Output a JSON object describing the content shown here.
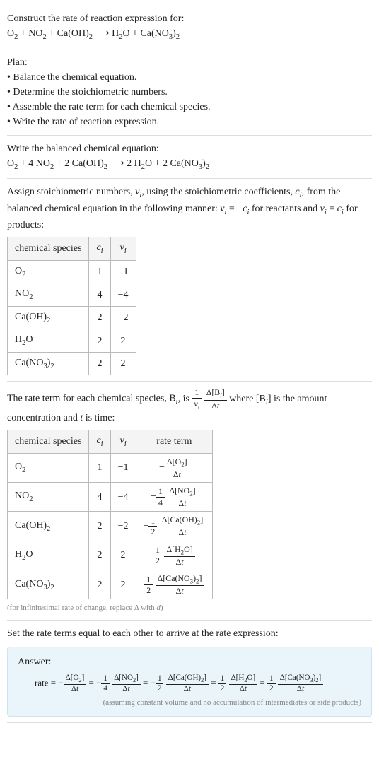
{
  "intro": {
    "prompt": "Construct the rate of reaction expression for:",
    "equation_html": "O<sub>2</sub> + NO<sub>2</sub> + Ca(OH)<sub>2</sub> ⟶ H<sub>2</sub>O + Ca(NO<sub>3</sub>)<sub>2</sub>"
  },
  "plan": {
    "title": "Plan:",
    "items": [
      "Balance the chemical equation.",
      "Determine the stoichiometric numbers.",
      "Assemble the rate term for each chemical species.",
      "Write the rate of reaction expression."
    ]
  },
  "balanced": {
    "intro": "Write the balanced chemical equation:",
    "equation_html": "O<sub>2</sub> + 4 NO<sub>2</sub> + 2 Ca(OH)<sub>2</sub> ⟶ 2 H<sub>2</sub>O + 2 Ca(NO<sub>3</sub>)<sub>2</sub>"
  },
  "stoich": {
    "intro_html": "Assign stoichiometric numbers, <i>ν<sub>i</sub></i>, using the stoichiometric coefficients, <i>c<sub>i</sub></i>, from the balanced chemical equation in the following manner: <i>ν<sub>i</sub></i> = −<i>c<sub>i</sub></i> for reactants and <i>ν<sub>i</sub></i> = <i>c<sub>i</sub></i> for products:",
    "headers": {
      "col1": "chemical species",
      "col2_html": "<i>c<sub>i</sub></i>",
      "col3_html": "<i>ν<sub>i</sub></i>"
    },
    "rows": [
      {
        "sp_html": "O<sub>2</sub>",
        "c": "1",
        "v": "−1"
      },
      {
        "sp_html": "NO<sub>2</sub>",
        "c": "4",
        "v": "−4"
      },
      {
        "sp_html": "Ca(OH)<sub>2</sub>",
        "c": "2",
        "v": "−2"
      },
      {
        "sp_html": "H<sub>2</sub>O",
        "c": "2",
        "v": "2"
      },
      {
        "sp_html": "Ca(NO<sub>3</sub>)<sub>2</sub>",
        "c": "2",
        "v": "2"
      }
    ]
  },
  "rate_terms": {
    "intro_pre": "The rate term for each chemical species, B",
    "intro_post_html": ", is <span class=\"frac\"><span class=\"num\">1</span><span class=\"den\"><i>ν<sub>i</sub></i></span></span> <span class=\"frac\"><span class=\"num\">Δ[B<sub><i>i</i></sub>]</span><span class=\"den\">Δ<i>t</i></span></span> where [B<sub><i>i</i></sub>] is the amount concentration and <i>t</i> is time:",
    "headers": {
      "col1": "chemical species",
      "col2_html": "<i>c<sub>i</sub></i>",
      "col3_html": "<i>ν<sub>i</sub></i>",
      "col4": "rate term"
    },
    "rows": [
      {
        "sp_html": "O<sub>2</sub>",
        "c": "1",
        "v": "−1",
        "term_html": "<span class=\"neg\">−<span class=\"frac\"><span class=\"num\">Δ[O<sub>2</sub>]</span><span class=\"den\">Δ<i>t</i></span></span></span>"
      },
      {
        "sp_html": "NO<sub>2</sub>",
        "c": "4",
        "v": "−4",
        "term_html": "<span class=\"neg\">−<span class=\"frac\"><span class=\"num\">1</span><span class=\"den\">4</span></span> <span class=\"frac\"><span class=\"num\">Δ[NO<sub>2</sub>]</span><span class=\"den\">Δ<i>t</i></span></span></span>"
      },
      {
        "sp_html": "Ca(OH)<sub>2</sub>",
        "c": "2",
        "v": "−2",
        "term_html": "<span class=\"neg\">−<span class=\"frac\"><span class=\"num\">1</span><span class=\"den\">2</span></span> <span class=\"frac\"><span class=\"num\">Δ[Ca(OH)<sub>2</sub>]</span><span class=\"den\">Δ<i>t</i></span></span></span>"
      },
      {
        "sp_html": "H<sub>2</sub>O",
        "c": "2",
        "v": "2",
        "term_html": "<span class=\"frac\"><span class=\"num\">1</span><span class=\"den\">2</span></span> <span class=\"frac\"><span class=\"num\">Δ[H<sub>2</sub>O]</span><span class=\"den\">Δ<i>t</i></span></span>"
      },
      {
        "sp_html": "Ca(NO<sub>3</sub>)<sub>2</sub>",
        "c": "2",
        "v": "2",
        "term_html": "<span class=\"frac\"><span class=\"num\">1</span><span class=\"den\">2</span></span> <span class=\"frac\"><span class=\"num\">Δ[Ca(NO<sub>3</sub>)<sub>2</sub>]</span><span class=\"den\">Δ<i>t</i></span></span>"
      }
    ],
    "footnote_html": "(for infinitesimal rate of change, replace Δ with <i>d</i>)"
  },
  "final": {
    "intro": "Set the rate terms equal to each other to arrive at the rate expression:",
    "answer_label": "Answer:",
    "expr_html": "rate = −<span class=\"frac\"><span class=\"num\">Δ[O<sub>2</sub>]</span><span class=\"den\">Δ<i>t</i></span></span> = −<span class=\"frac\"><span class=\"num\">1</span><span class=\"den\">4</span></span> <span class=\"frac\"><span class=\"num\">Δ[NO<sub>2</sub>]</span><span class=\"den\">Δ<i>t</i></span></span> = −<span class=\"frac\"><span class=\"num\">1</span><span class=\"den\">2</span></span> <span class=\"frac\"><span class=\"num\">Δ[Ca(OH)<sub>2</sub>]</span><span class=\"den\">Δ<i>t</i></span></span> = <span class=\"frac\"><span class=\"num\">1</span><span class=\"den\">2</span></span> <span class=\"frac\"><span class=\"num\">Δ[H<sub>2</sub>O]</span><span class=\"den\">Δ<i>t</i></span></span> = <span class=\"frac\"><span class=\"num\">1</span><span class=\"den\">2</span></span> <span class=\"frac\"><span class=\"num\">Δ[Ca(NO<sub>3</sub>)<sub>2</sub>]</span><span class=\"den\">Δ<i>t</i></span></span>",
    "assumption": "(assuming constant volume and no accumulation of intermediates or side products)"
  },
  "chart_data": {
    "type": "table",
    "title": "Stoichiometric numbers and rate terms",
    "columns": [
      "chemical species",
      "c_i",
      "ν_i",
      "rate term"
    ],
    "rows": [
      [
        "O2",
        1,
        -1,
        "-Δ[O2]/Δt"
      ],
      [
        "NO2",
        4,
        -4,
        "-(1/4) Δ[NO2]/Δt"
      ],
      [
        "Ca(OH)2",
        2,
        -2,
        "-(1/2) Δ[Ca(OH)2]/Δt"
      ],
      [
        "H2O",
        2,
        2,
        "(1/2) Δ[H2O]/Δt"
      ],
      [
        "Ca(NO3)2",
        2,
        2,
        "(1/2) Δ[Ca(NO3)2]/Δt"
      ]
    ]
  }
}
